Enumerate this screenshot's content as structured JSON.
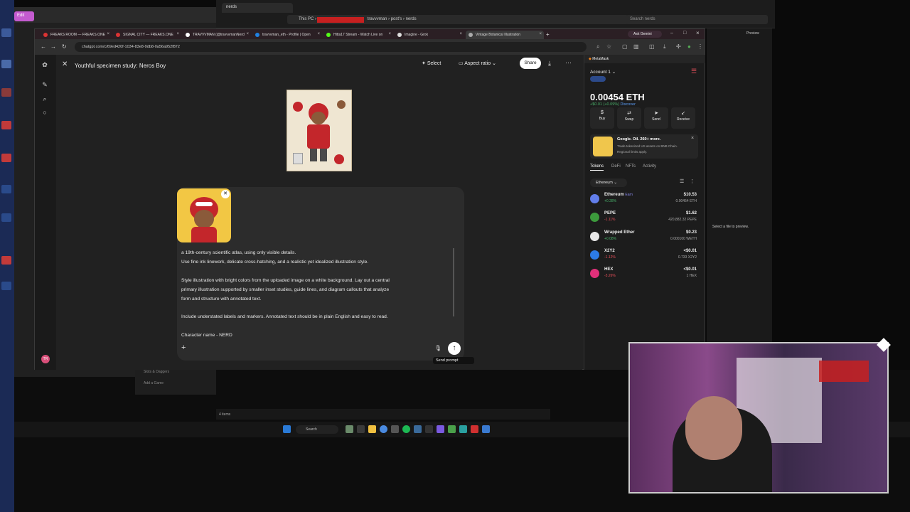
{
  "explorer": {
    "tab": "nerds",
    "path_root": "This PC",
    "path_user": "travvvman",
    "path_posts": "post's",
    "path_folder": "nerds",
    "search_placeholder": "Search nerds",
    "item_count": "4 items"
  },
  "left_app": {
    "edit_label": "Edit",
    "list_item": "Slots & Daggers",
    "add_game": "Add a Game"
  },
  "browser": {
    "tabs": [
      {
        "label": "FREAKS ROOM — FREAKS.ONE"
      },
      {
        "label": "SIGNAL CITY — FREAKS.ONE"
      },
      {
        "label": "TRAVVVMAN (@travvvmanNerd"
      },
      {
        "label": "travvvman_eth - Profile | Open"
      },
      {
        "label": "Hitta17 Stream - Watch Live on"
      },
      {
        "label": "Imagine - Grok"
      },
      {
        "label": "Vintage Botanical Illustration"
      }
    ],
    "new_tab": "+",
    "ask_gemini": "Ask Gemini",
    "url": "chatgpt.com/c/69ed420f-1034-83e8-9db8-0a56a952f872"
  },
  "chat": {
    "title": "Youthful specimen study: Neros Boy",
    "select_label": "Select",
    "aspect_label": "Aspect ratio",
    "share_label": "Share",
    "prompt_lines": [
      "a 19th-century scientific atlas, using only visible details.",
      "Use fine ink linework, delicate cross-hatching, and a realistic yet idealized illustration style.",
      "Style illustration with bright colors from the uploaded image on a white background. Lay out a central",
      "primary illustration supported by smaller inset studies, guide lines, and diagram callouts that analyze",
      "form and structure with annotated text.",
      "Include understated labels and markers. Annotated text should be in plain English and easy to read.",
      "Character name - NERD"
    ],
    "send_tooltip": "Send prompt",
    "avatar_initials": "TR"
  },
  "metamask": {
    "header": "MetaMask",
    "account": "Account 1",
    "balance": "0.00454 ETH",
    "change": "+$0.01 (+0.09%)",
    "discover": "Discover",
    "actions": [
      {
        "label": "Buy",
        "icon": "$"
      },
      {
        "label": "Swap",
        "icon": "⇄"
      },
      {
        "label": "Send",
        "icon": "➤"
      },
      {
        "label": "Receive",
        "icon": "↙"
      }
    ],
    "promo_title": "Google. Oil. 260+ more.",
    "promo_body_1": "Trade tokenized US assets on BNB Chain.",
    "promo_body_2": "Regional limits apply.",
    "tabs": [
      "Tokens",
      "DeFi",
      "NFTs",
      "Activity"
    ],
    "network": "Ethereum",
    "earn_label": "Earn",
    "tokens": [
      {
        "name": "Ethereum",
        "change": "+0.28%",
        "value": "$10.53",
        "balance": "0.00454 ETH",
        "color": "#627eea",
        "dir": "up"
      },
      {
        "name": "PEPE",
        "change": "-1.11%",
        "value": "$1.62",
        "balance": "420,882.32 PEPE",
        "color": "#3c9a3c",
        "dir": "down"
      },
      {
        "name": "Wrapped Ether",
        "change": "+0.08%",
        "value": "$0.23",
        "balance": "0.000100 WETH",
        "color": "#e8e8e8",
        "dir": "up"
      },
      {
        "name": "X2Y2",
        "change": "-1.12%",
        "value": "<$0.01",
        "balance": "0.733 X2Y2",
        "color": "#2c7be5",
        "dir": "down"
      },
      {
        "name": "HEX",
        "change": "-3.26%",
        "value": "<$0.01",
        "balance": "1 HEX",
        "color": "#e0307a",
        "dir": "down"
      }
    ]
  },
  "preview": {
    "label": "Preview",
    "placeholder": "Select a file to preview."
  },
  "taskbar": {
    "search": "Search"
  }
}
